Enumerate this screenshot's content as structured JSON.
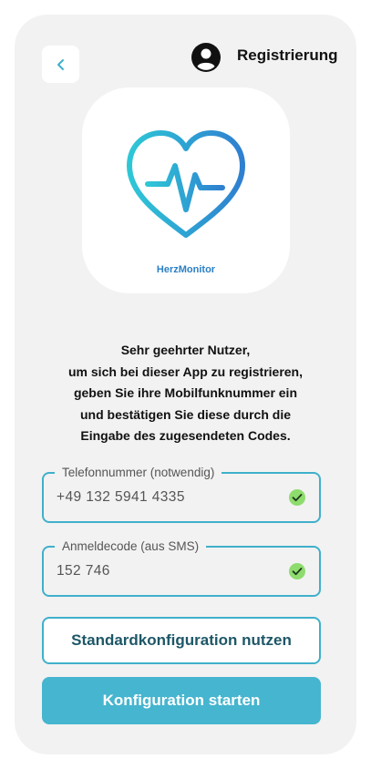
{
  "header": {
    "title": "Registrierung",
    "back_icon": "chevron-left-icon",
    "user_icon": "account-circle-icon"
  },
  "app": {
    "name": "HerzMonitor",
    "logo_icon": "heart-pulse-icon"
  },
  "intro_text": "Sehr geehrter Nutzer,\num sich bei dieser App zu registrieren,\ngeben Sie ihre Mobilfunknummer ein\nund bestätigen Sie diese durch die\nEingabe des zugesendeten Codes.",
  "fields": {
    "phone": {
      "label": "Telefonnummer (notwendig)",
      "value": "+49 132 5941 4335",
      "status_icon": "check-circle-icon"
    },
    "code": {
      "label": "Anmeldecode (aus SMS)",
      "value": "152 746",
      "status_icon": "check-circle-icon"
    }
  },
  "buttons": {
    "default_config": "Standardkonfiguration nutzen",
    "start_config": "Konfiguration starten"
  },
  "colors": {
    "accent": "#46b5cf",
    "field_border": "#3fb0cb",
    "check_green": "#8fdc6e",
    "app_name": "#2b7fc4"
  }
}
